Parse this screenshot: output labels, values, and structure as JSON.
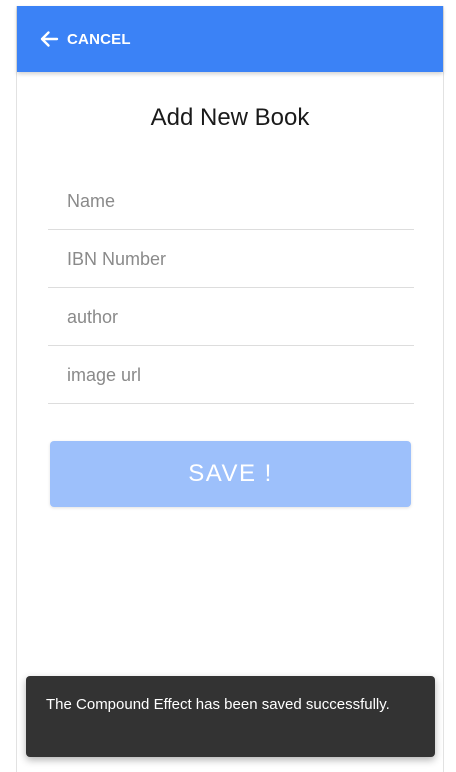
{
  "appbar": {
    "cancel_label": "CANCEL",
    "icon": "arrow-left-icon",
    "color": "#3b82f6"
  },
  "page": {
    "title": "Add New Book"
  },
  "form": {
    "fields": [
      {
        "placeholder": "Name",
        "value": ""
      },
      {
        "placeholder": "IBN Number",
        "value": ""
      },
      {
        "placeholder": "author",
        "value": ""
      },
      {
        "placeholder": "image url",
        "value": ""
      }
    ],
    "save_label": "SAVE !",
    "save_color": "#9dc0fb"
  },
  "snackbar": {
    "message": "The Compound Effect  has been saved successfully.",
    "background": "#333333"
  }
}
